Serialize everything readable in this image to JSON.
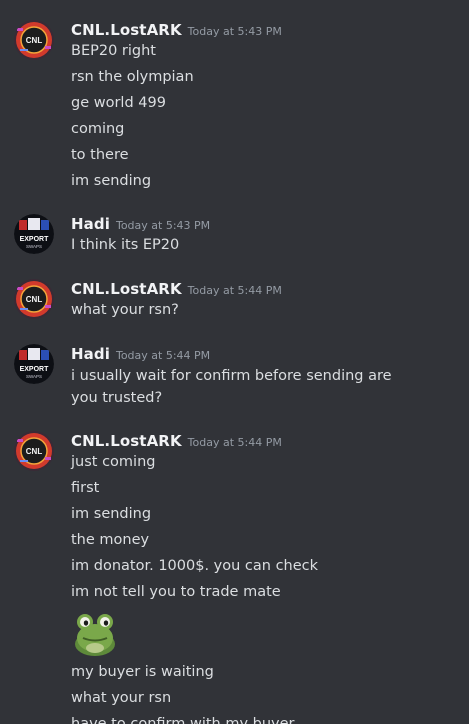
{
  "groups": [
    {
      "author": "CNL.LostARK",
      "timestamp": "Today at 5:43 PM",
      "lines": [
        "BEP20 right",
        "rsn the olympian",
        "ge world 499",
        "coming",
        "to there",
        "im sending"
      ]
    },
    {
      "author": "Hadi",
      "timestamp": "Today at 5:43 PM",
      "lines": [
        "I think its EP20"
      ]
    },
    {
      "author": "CNL.LostARK",
      "timestamp": "Today at 5:44 PM",
      "lines": [
        "what your rsn?"
      ]
    },
    {
      "author": "Hadi",
      "timestamp": "Today at 5:44 PM",
      "lines": [
        "i usually wait for confirm before sending are you trusted?"
      ]
    },
    {
      "author": "CNL.LostARK",
      "timestamp": "Today at 5:44 PM",
      "lines": [
        "just coming",
        "first",
        "im sending",
        "the money",
        "im donator. 1000$. you can check",
        "im not tell you to trade mate"
      ],
      "after_sticker_lines": [
        "my buyer is waiting",
        "what your rsn",
        "have to confirm with my buyer"
      ]
    }
  ],
  "avatars": {
    "cnl_logo_text": "CNL",
    "hadi_logo_text": "EXPORT",
    "hadi_logo_subtext": "SWAPS"
  },
  "colors": {
    "background": "#313338",
    "author": "#f2f3f5",
    "timestamp": "#949ba4",
    "message_text": "#dbdee1"
  }
}
